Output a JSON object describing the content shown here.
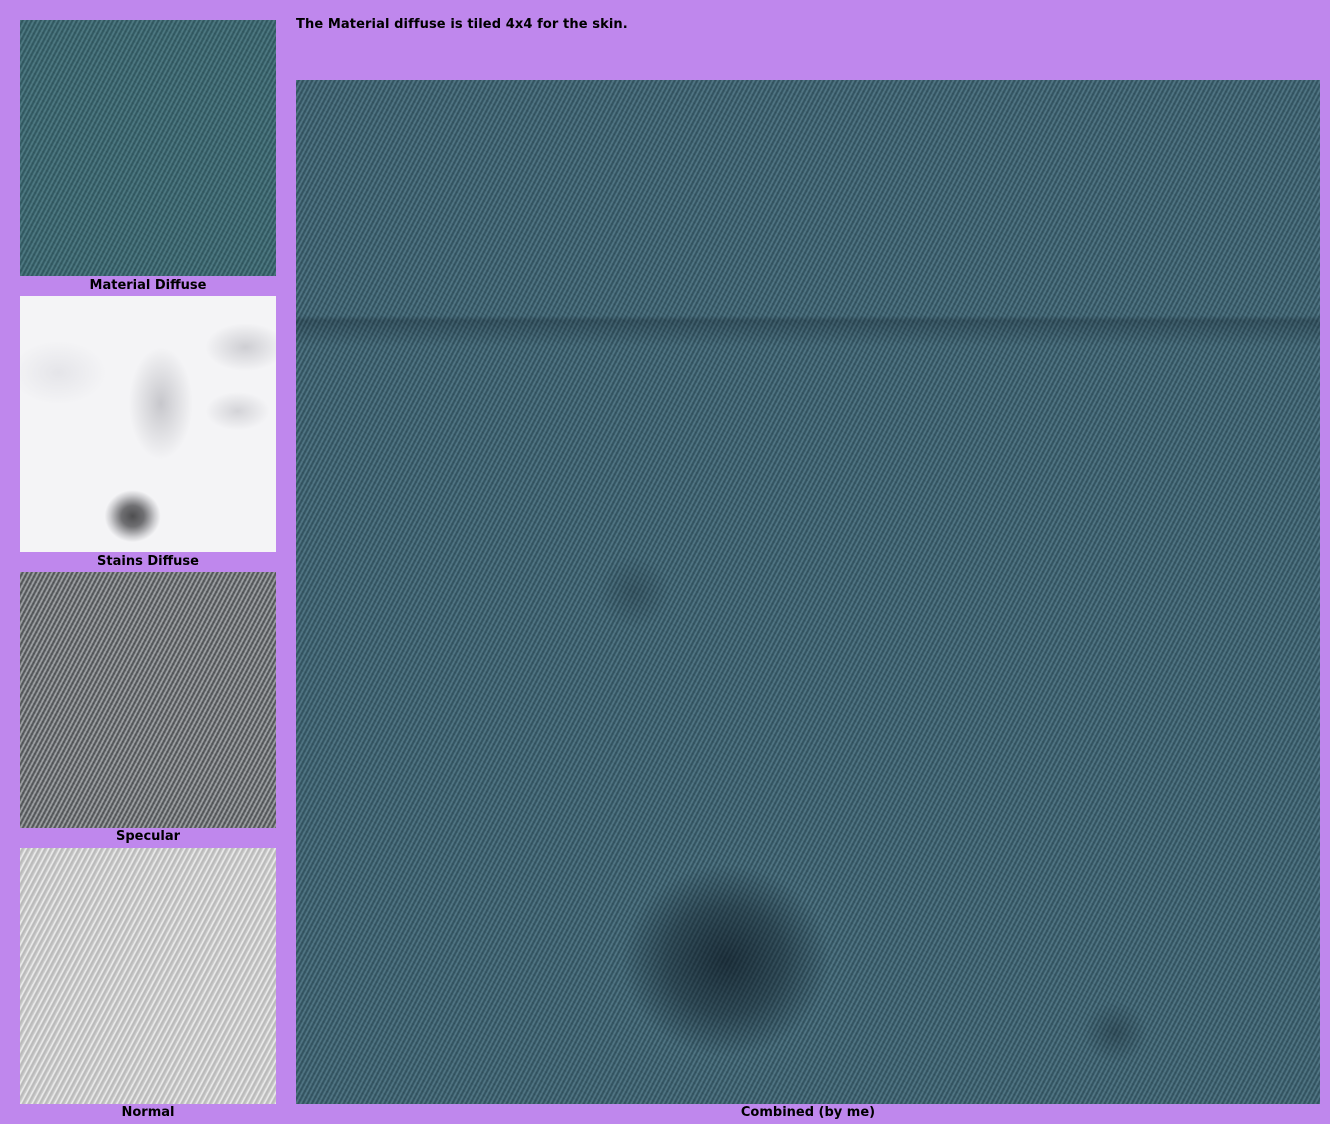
{
  "page": {
    "background_color": "#bf87ed",
    "note": "The Material diffuse is tiled 4x4 for the skin."
  },
  "textures": [
    {
      "caption": "Material Diffuse",
      "icon": "material-diffuse-texture"
    },
    {
      "caption": "Stains Diffuse",
      "icon": "stains-diffuse-texture"
    },
    {
      "caption": "Specular",
      "icon": "specular-texture"
    },
    {
      "caption": "Normal",
      "icon": "normal-map-texture"
    }
  ],
  "combined": {
    "caption": "Combined (by me)",
    "icon": "combined-texture"
  }
}
